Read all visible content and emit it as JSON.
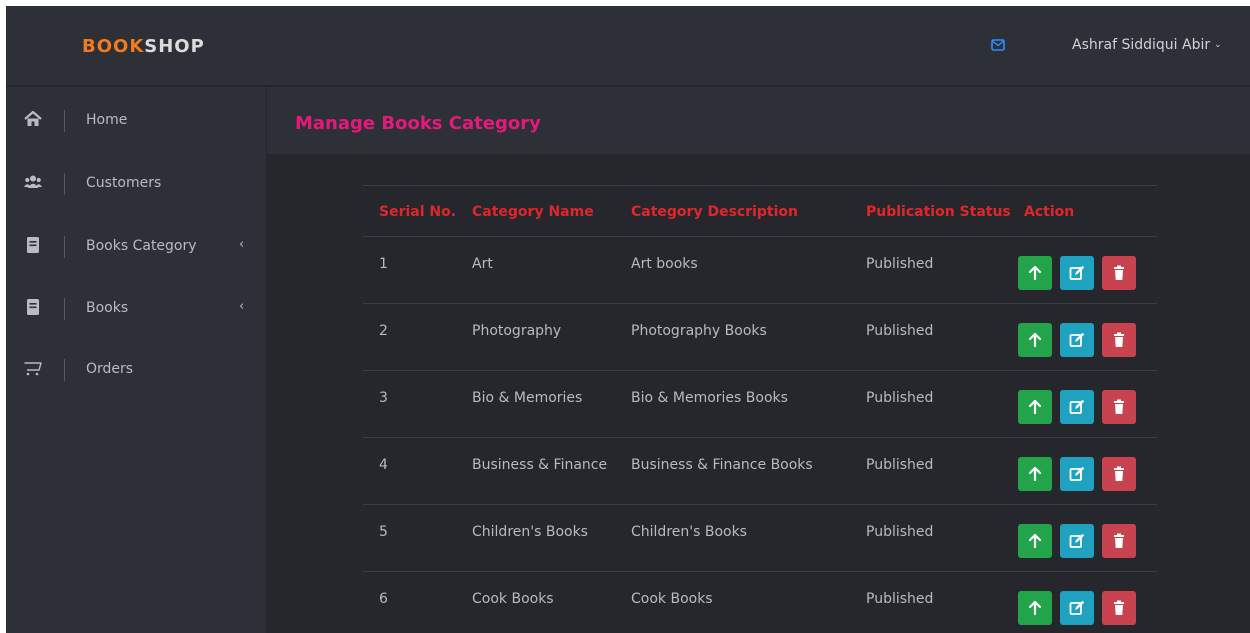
{
  "header": {
    "brand_part1": "BOOK",
    "brand_part2": "SHOP",
    "user_name": "Ashraf Siddiqui Abir",
    "user_caret": "⌄"
  },
  "sidebar": {
    "items": [
      {
        "label": "Home",
        "icon": "home-icon",
        "has_caret": false
      },
      {
        "label": "Customers",
        "icon": "users-icon",
        "has_caret": false
      },
      {
        "label": "Books Category",
        "icon": "book-icon",
        "has_caret": true,
        "caret": "‹"
      },
      {
        "label": "Books",
        "icon": "book-icon",
        "has_caret": true,
        "caret": "‹"
      },
      {
        "label": "Orders",
        "icon": "cart-icon",
        "has_caret": false
      }
    ]
  },
  "page": {
    "title": "Manage Books Category"
  },
  "table": {
    "columns": [
      "Serial No.",
      "Category Name",
      "Category Description",
      "Publication Status",
      "Action"
    ],
    "rows": [
      {
        "serial": "1",
        "name": "Art",
        "description": "Art books",
        "status": "Published"
      },
      {
        "serial": "2",
        "name": "Photography",
        "description": "Photography Books",
        "status": "Published"
      },
      {
        "serial": "3",
        "name": "Bio & Memories",
        "description": "Bio & Memories Books",
        "status": "Published"
      },
      {
        "serial": "4",
        "name": "Business & Finance",
        "description": "Business & Finance Books",
        "status": "Published"
      },
      {
        "serial": "5",
        "name": "Children's Books",
        "description": "Children's Books",
        "status": "Published"
      },
      {
        "serial": "6",
        "name": "Cook Books",
        "description": "Cook Books",
        "status": "Published"
      }
    ]
  },
  "colors": {
    "accent_title": "#e6197b",
    "table_header": "#e0262d",
    "brand_orange": "#f47a20",
    "btn_publish": "#23a34a",
    "btn_edit": "#1ea2bf",
    "btn_delete": "#c9424f"
  }
}
